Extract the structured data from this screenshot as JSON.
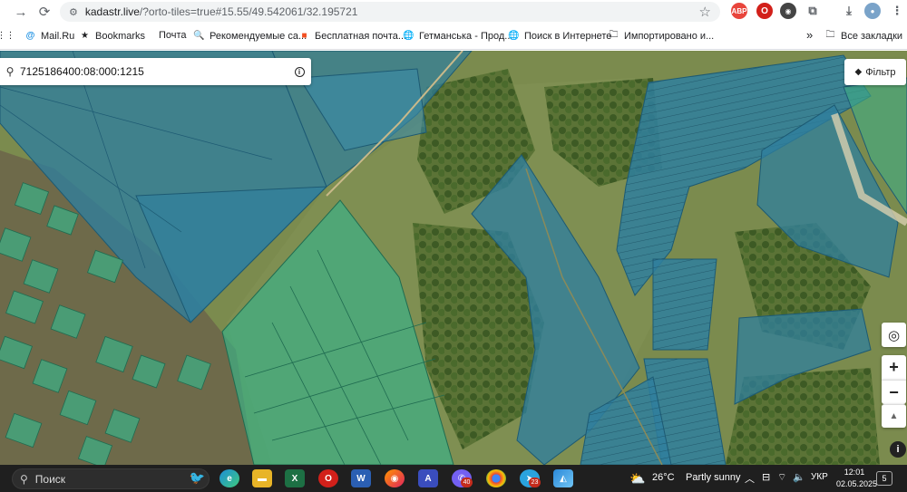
{
  "browser": {
    "url_host": "kadastr.live",
    "url_path": "/?orto-tiles=true#15.55/49.542061/32.195721",
    "back_icon": "arrow-left-icon",
    "forward_icon": "arrow-right-icon",
    "reload_icon": "reload-icon",
    "star_icon": "star-icon",
    "extensions": {
      "abp_label": "ABP",
      "opera_label": "O"
    }
  },
  "bookmarks": {
    "items": [
      {
        "label": "Mail.Ru"
      },
      {
        "label": "Bookmarks"
      },
      {
        "label": "Почта"
      },
      {
        "label": "Рекомендуемые са..."
      },
      {
        "label": "Бесплатная почта..."
      },
      {
        "label": "Гетманська - Прод..."
      },
      {
        "label": "Поиск в Интернете"
      },
      {
        "label": "Импортировано и..."
      }
    ],
    "more_label": "»",
    "all_label": "Все закладки"
  },
  "map": {
    "search_value": "7125186400:08:000:1215",
    "info_label": "i",
    "filter_label": "Фільтр",
    "locate_label": "◎",
    "zoom_in_label": "+",
    "zoom_out_label": "−",
    "compass_label": "▲",
    "attribution_label": "i",
    "colors": {
      "parcel_blue": "#2f7f9e",
      "parcel_green": "#3fae84",
      "vegetation": "#6f7f46"
    }
  },
  "taskbar": {
    "search_label": "Поиск",
    "apps": [
      {
        "name": "edge"
      },
      {
        "name": "file-explorer"
      },
      {
        "name": "excel",
        "label": "X"
      },
      {
        "name": "opera",
        "label": "O"
      },
      {
        "name": "word",
        "label": "W"
      },
      {
        "name": "firefox"
      },
      {
        "name": "app-a",
        "label": "A"
      },
      {
        "name": "viber",
        "badge": "40"
      },
      {
        "name": "chrome"
      },
      {
        "name": "telegram",
        "badge": "23"
      },
      {
        "name": "photos"
      }
    ],
    "weather_temp": "26°C",
    "weather_text": "Partly sunny",
    "lang": "УКР",
    "time": "12:01",
    "date": "02.05.2025",
    "notifications": "5"
  }
}
